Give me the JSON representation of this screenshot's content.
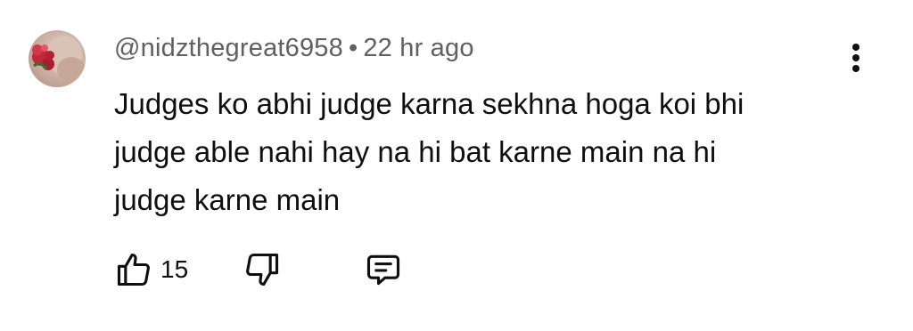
{
  "comment": {
    "author": "@nidzthegreat6958",
    "separator": "•",
    "time": "22 hr ago",
    "text_lines": [
      "Judges ko abhi judge karna sekhna hoga koi bhi",
      "judge able nahi hay na hi bat karne main na hi",
      "judge karne main"
    ],
    "like_count": "15"
  },
  "icons": {
    "avatar": "profile-photo",
    "more": "vertical-dots-icon",
    "like": "thumbs-up-icon",
    "dislike": "thumbs-down-icon",
    "reply": "comment-reply-icon"
  },
  "colors": {
    "text": "#0f0f0f",
    "meta": "#606060"
  }
}
